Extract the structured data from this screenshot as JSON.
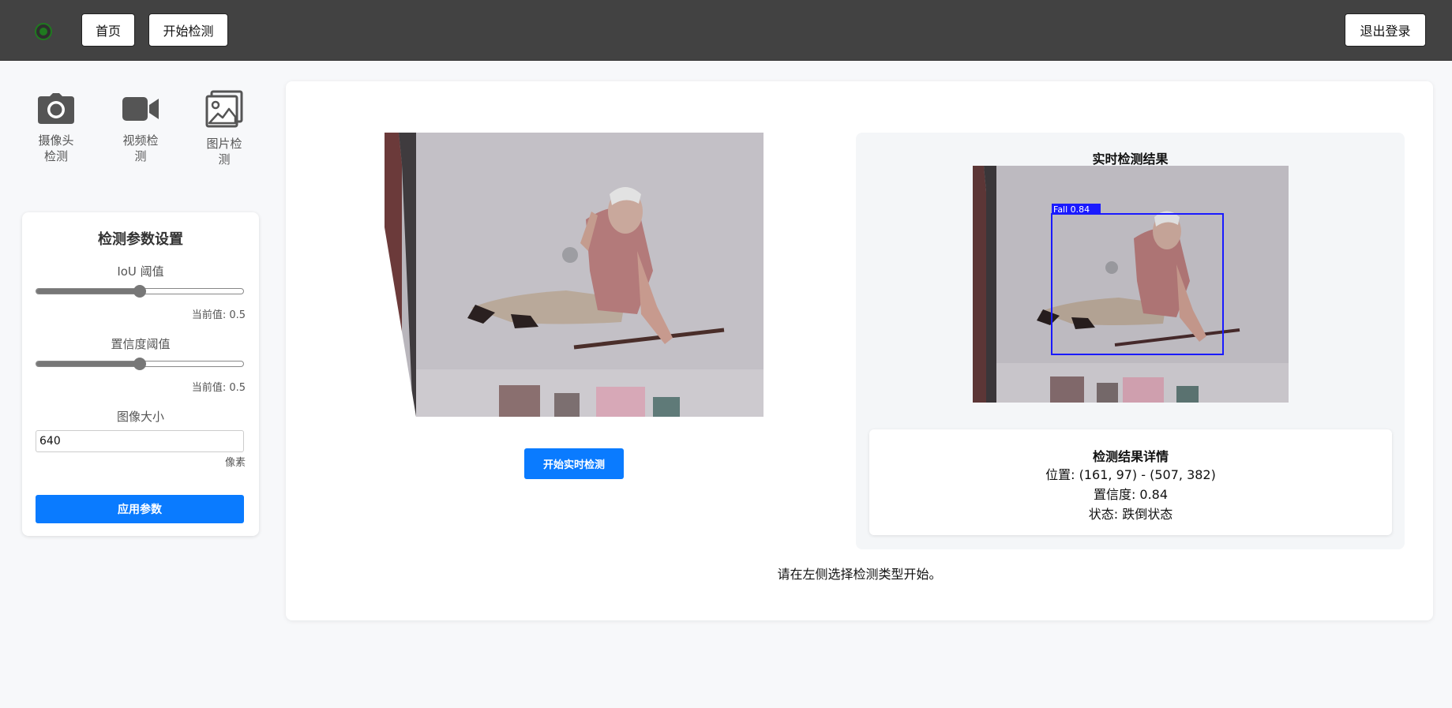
{
  "topbar": {
    "home_label": "首页",
    "start_label": "开始检测",
    "logout_label": "退出登录"
  },
  "sidebar": {
    "items": [
      {
        "label": "摄像头检测",
        "icon": "camera-icon"
      },
      {
        "label": "视频检测",
        "icon": "video-icon"
      },
      {
        "label": "图片检测",
        "icon": "image-icon"
      }
    ],
    "params": {
      "title": "检测参数设置",
      "iou_label": "IoU 阈值",
      "iou_value": 0.5,
      "iou_current": "当前值: 0.5",
      "conf_label": "置信度阈值",
      "conf_value": 0.5,
      "conf_current": "当前值: 0.5",
      "size_label": "图像大小",
      "size_value": "640",
      "size_unit": "像素",
      "apply_label": "应用参数"
    }
  },
  "main": {
    "start_realtime_label": "开始实时检测",
    "result_title": "实时检测结果",
    "detection_box_label": "Fall 0.84",
    "details_title": "检测结果详情",
    "details_position": "位置: (161, 97) - (507, 382)",
    "details_confidence": "置信度: 0.84",
    "details_status": "状态: 跌倒状态",
    "hint": "请在左侧选择检测类型开始。"
  },
  "colors": {
    "topbar_bg": "#424242",
    "accent": "#0a7bff",
    "box": "#1a1aff"
  }
}
